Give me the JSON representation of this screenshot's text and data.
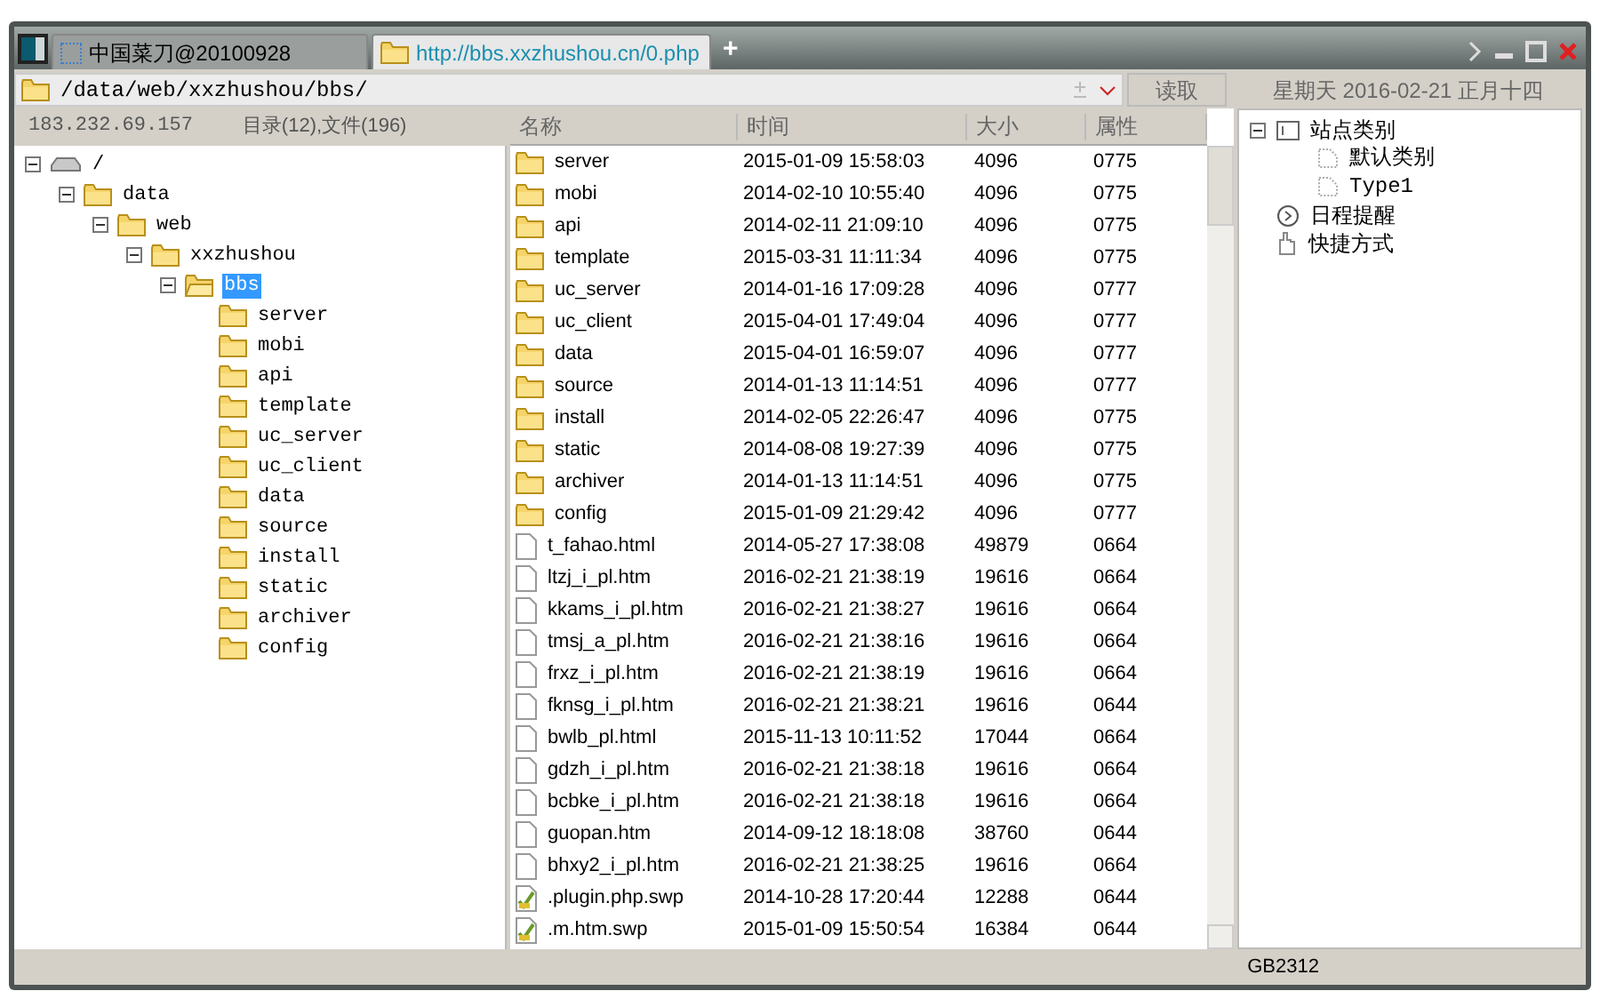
{
  "tabs": [
    {
      "label": "中国菜刀@20100928",
      "kind": "app",
      "selected": false
    },
    {
      "label": "http://bbs.xxzhushou.cn/0.php",
      "kind": "folder",
      "selected": true
    }
  ],
  "new_tab": "+",
  "address": {
    "value": "/data/web/xxzhushou/bbs/",
    "read_button": "读取"
  },
  "date": "星期天 2016-02-21 正月十四",
  "info": {
    "ip": "183.232.69.157",
    "counts": "目录(12),文件(196)"
  },
  "tree": [
    {
      "label": "/",
      "kind": "drive",
      "expanded": true,
      "selected": false,
      "children": [
        {
          "label": "data",
          "kind": "folder",
          "expanded": true,
          "selected": false,
          "children": [
            {
              "label": "web",
              "kind": "folder",
              "expanded": true,
              "selected": false,
              "children": [
                {
                  "label": "xxzhushou",
                  "kind": "folder",
                  "expanded": true,
                  "selected": false,
                  "children": [
                    {
                      "label": "bbs",
                      "kind": "open-folder",
                      "expanded": true,
                      "selected": true,
                      "children": [
                        {
                          "label": "server",
                          "kind": "folder",
                          "selected": false
                        },
                        {
                          "label": "mobi",
                          "kind": "folder",
                          "selected": false
                        },
                        {
                          "label": "api",
                          "kind": "folder",
                          "selected": false
                        },
                        {
                          "label": "template",
                          "kind": "folder",
                          "selected": false
                        },
                        {
                          "label": "uc_server",
                          "kind": "folder",
                          "selected": false
                        },
                        {
                          "label": "uc_client",
                          "kind": "folder",
                          "selected": false
                        },
                        {
                          "label": "data",
                          "kind": "folder",
                          "selected": false
                        },
                        {
                          "label": "source",
                          "kind": "folder",
                          "selected": false
                        },
                        {
                          "label": "install",
                          "kind": "folder",
                          "selected": false
                        },
                        {
                          "label": "static",
                          "kind": "folder",
                          "selected": false
                        },
                        {
                          "label": "archiver",
                          "kind": "folder",
                          "selected": false
                        },
                        {
                          "label": "config",
                          "kind": "folder",
                          "selected": false
                        }
                      ]
                    }
                  ]
                }
              ]
            }
          ]
        }
      ]
    }
  ],
  "table": {
    "columns": [
      "名称",
      "时间",
      "大小",
      "属性"
    ],
    "rows": [
      {
        "kind": "folder",
        "name": "server",
        "time": "2015-01-09 15:58:03",
        "size": "4096",
        "mode": "0775"
      },
      {
        "kind": "folder",
        "name": "mobi",
        "time": "2014-02-10 10:55:40",
        "size": "4096",
        "mode": "0775"
      },
      {
        "kind": "folder",
        "name": "api",
        "time": "2014-02-11 21:09:10",
        "size": "4096",
        "mode": "0775"
      },
      {
        "kind": "folder",
        "name": "template",
        "time": "2015-03-31 11:11:34",
        "size": "4096",
        "mode": "0775"
      },
      {
        "kind": "folder",
        "name": "uc_server",
        "time": "2014-01-16 17:09:28",
        "size": "4096",
        "mode": "0777"
      },
      {
        "kind": "folder",
        "name": "uc_client",
        "time": "2015-04-01 17:49:04",
        "size": "4096",
        "mode": "0777"
      },
      {
        "kind": "folder",
        "name": "data",
        "time": "2015-04-01 16:59:07",
        "size": "4096",
        "mode": "0777"
      },
      {
        "kind": "folder",
        "name": "source",
        "time": "2014-01-13 11:14:51",
        "size": "4096",
        "mode": "0777"
      },
      {
        "kind": "folder",
        "name": "install",
        "time": "2014-02-05 22:26:47",
        "size": "4096",
        "mode": "0775"
      },
      {
        "kind": "folder",
        "name": "static",
        "time": "2014-08-08 19:27:39",
        "size": "4096",
        "mode": "0775"
      },
      {
        "kind": "folder",
        "name": "archiver",
        "time": "2014-01-13 11:14:51",
        "size": "4096",
        "mode": "0775"
      },
      {
        "kind": "folder",
        "name": "config",
        "time": "2015-01-09 21:29:42",
        "size": "4096",
        "mode": "0777"
      },
      {
        "kind": "file",
        "name": "t_fahao.html",
        "time": "2014-05-27 17:38:08",
        "size": "49879",
        "mode": "0664"
      },
      {
        "kind": "file",
        "name": "ltzj_i_pl.htm",
        "time": "2016-02-21 21:38:19",
        "size": "19616",
        "mode": "0664"
      },
      {
        "kind": "file",
        "name": "kkams_i_pl.htm",
        "time": "2016-02-21 21:38:27",
        "size": "19616",
        "mode": "0664"
      },
      {
        "kind": "file",
        "name": "tmsj_a_pl.htm",
        "time": "2016-02-21 21:38:16",
        "size": "19616",
        "mode": "0664"
      },
      {
        "kind": "file",
        "name": "frxz_i_pl.htm",
        "time": "2016-02-21 21:38:19",
        "size": "19616",
        "mode": "0664"
      },
      {
        "kind": "file",
        "name": "fknsg_i_pl.htm",
        "time": "2016-02-21 21:38:21",
        "size": "19616",
        "mode": "0644"
      },
      {
        "kind": "file",
        "name": "bwlb_pl.html",
        "time": "2015-11-13 10:11:52",
        "size": "17044",
        "mode": "0664"
      },
      {
        "kind": "file",
        "name": "gdzh_i_pl.htm",
        "time": "2016-02-21 21:38:18",
        "size": "19616",
        "mode": "0664"
      },
      {
        "kind": "file",
        "name": "bcbke_i_pl.htm",
        "time": "2016-02-21 21:38:18",
        "size": "19616",
        "mode": "0664"
      },
      {
        "kind": "file",
        "name": "guopan.htm",
        "time": "2014-09-12 18:18:08",
        "size": "38760",
        "mode": "0644"
      },
      {
        "kind": "file",
        "name": "bhxy2_i_pl.htm",
        "time": "2016-02-21 21:38:25",
        "size": "19616",
        "mode": "0664"
      },
      {
        "kind": "swap",
        "name": ".plugin.php.swp",
        "time": "2014-10-28 17:20:44",
        "size": "12288",
        "mode": "0644"
      },
      {
        "kind": "swap",
        "name": ".m.htm.swp",
        "time": "2015-01-09 15:50:54",
        "size": "16384",
        "mode": "0644"
      }
    ]
  },
  "side_tree": [
    {
      "label": "站点类别",
      "kind": "category",
      "expanded": true,
      "children": [
        {
          "label": "默认类别",
          "kind": "page"
        },
        {
          "label": "Type1",
          "kind": "page"
        }
      ]
    },
    {
      "label": "日程提醒",
      "kind": "schedule"
    },
    {
      "label": "快捷方式",
      "kind": "shortcut"
    }
  ],
  "status_bar": {
    "encoding": "GB2312"
  }
}
